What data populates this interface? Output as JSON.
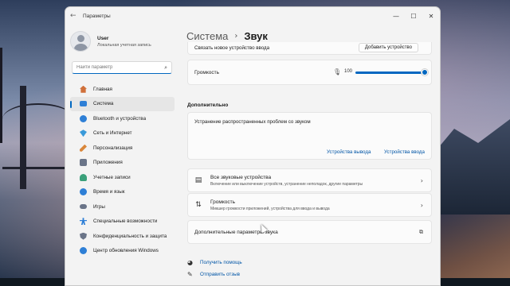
{
  "window": {
    "title": "Параметры",
    "controls": [
      "minimize-icon",
      "maximize-icon",
      "close-icon"
    ]
  },
  "user": {
    "name": "User",
    "account_type": "Локальная учетная запись"
  },
  "search": {
    "placeholder": "Найти параметр",
    "value": ""
  },
  "sidebar": {
    "items": [
      {
        "label": "Главная",
        "icon": "home-icon",
        "color": "#d0703a"
      },
      {
        "label": "Система",
        "icon": "system-icon",
        "color": "#2e7fd6",
        "active": true
      },
      {
        "label": "Bluetooth и устройства",
        "icon": "bluetooth-icon",
        "color": "#2e7fd6"
      },
      {
        "label": "Сеть и Интернет",
        "icon": "network-icon",
        "color": "#3a9ad9"
      },
      {
        "label": "Персонализация",
        "icon": "brush-icon",
        "color": "#d9863a"
      },
      {
        "label": "Приложения",
        "icon": "apps-icon",
        "color": "#6a7488"
      },
      {
        "label": "Учетные записи",
        "icon": "account-icon",
        "color": "#3aa07a"
      },
      {
        "label": "Время и язык",
        "icon": "globe-clock-icon",
        "color": "#2e7fd6"
      },
      {
        "label": "Игры",
        "icon": "gamepad-icon",
        "color": "#6a7488"
      },
      {
        "label": "Специальные возможности",
        "icon": "accessibility-icon",
        "color": "#2e7fd6"
      },
      {
        "label": "Конфиденциальность и защита",
        "icon": "shield-icon",
        "color": "#6a7488"
      },
      {
        "label": "Центр обновления Windows",
        "icon": "update-icon",
        "color": "#2e7fd6"
      }
    ]
  },
  "breadcrumb": {
    "parent": "Система",
    "separator": "›",
    "current": "Звук"
  },
  "input_devices": {
    "connect_label": "Связать новое устройство ввода",
    "connect_button": "Добавить устройство"
  },
  "volume": {
    "label": "Громкость",
    "value": "100",
    "level": 1.0
  },
  "advanced": {
    "title": "Дополнительно",
    "troubleshoot": {
      "label": "Устранение распространенных проблем со звуком",
      "output_link": "Устройства вывода",
      "input_link": "Устройства ввода"
    },
    "all_devices": {
      "title": "Все звуковые устройства",
      "subtitle": "Включение или выключение устройств, устранение неполадок, другие параметры"
    },
    "mixer": {
      "title": "Громкость",
      "subtitle": "Микшер громкости приложений, устройства для ввода и вывода"
    },
    "more_settings": "Дополнительные параметры звука"
  },
  "help": {
    "get_help": "Получить помощь",
    "feedback": "Отправить отзыв"
  },
  "colors": {
    "accent": "#0067c0",
    "link": "#0055a6"
  }
}
